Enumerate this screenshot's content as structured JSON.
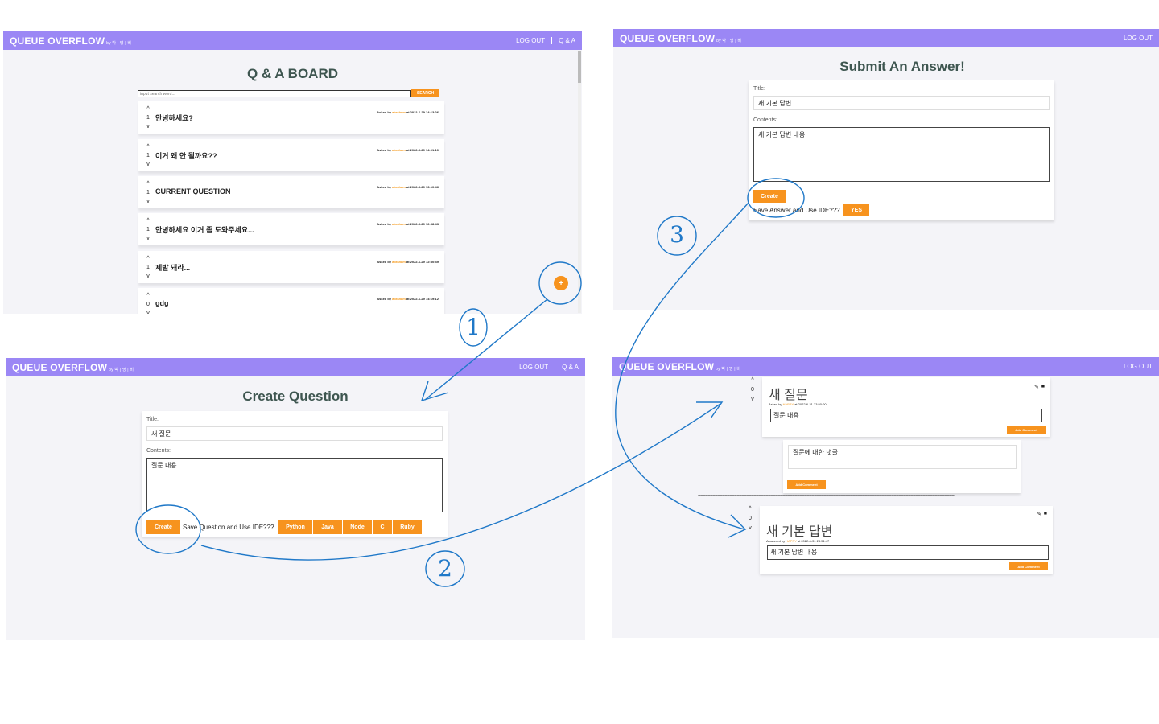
{
  "brand": {
    "name": "QUEUE OVERFLOW",
    "by": "by 박 | 명 | 비"
  },
  "nav": {
    "logout": "LOG OUT",
    "qa": "Q & A"
  },
  "board": {
    "title": "Q & A BOARD",
    "search_placeholder": "input search word...",
    "search_button": "SEARCH",
    "questions": [
      {
        "votes": "1",
        "title": "안녕하세요?",
        "asked_by": "Asked by",
        "user": "abraham",
        "at": "at 2022-6-29 14:13:26"
      },
      {
        "votes": "1",
        "title": "이거 왜 안 될까요??",
        "asked_by": "Asked by",
        "user": "abraham",
        "at": "at 2022-6-29 14:01:10"
      },
      {
        "votes": "1",
        "title": "CURRENT QUESTION",
        "asked_by": "Asked by",
        "user": "abraham",
        "at": "at 2022-6-29 13:10:46"
      },
      {
        "votes": "1",
        "title": "안녕하세요 이거 좀 도와주세요...",
        "asked_by": "Asked by",
        "user": "abraham",
        "at": "at 2022-6-29 12:58:43"
      },
      {
        "votes": "1",
        "title": "제발 돼라...",
        "asked_by": "Asked by",
        "user": "abraham",
        "at": "at 2022-6-29 12:30:49"
      },
      {
        "votes": "0",
        "title": "gdg",
        "asked_by": "Asked by",
        "user": "abraham",
        "at": "at 2022-6-29 14:19:12"
      }
    ],
    "add_button": "+"
  },
  "answer": {
    "title": "Submit An Answer!",
    "title_label": "Title:",
    "title_value": "새 기본 답변",
    "contents_label": "Contents:",
    "contents_value": "새 기본 답변 내용",
    "create": "Create",
    "save_text": "Save Answer and Use IDE???",
    "yes": "YES"
  },
  "create": {
    "title": "Create Question",
    "title_label": "Title:",
    "title_value": "새 질문",
    "contents_label": "Contents:",
    "contents_value": "질문 내용",
    "create": "Create",
    "save_text": "Save Question and Use IDE???",
    "langs": [
      "Python",
      "Java",
      "Node",
      "C",
      "Ruby"
    ]
  },
  "detail": {
    "question_votes": "0",
    "question_title": "새 질문",
    "question_asked_by": "Asked by",
    "question_user": "HAPPY",
    "question_at": "at 2022-6-31 23:50:00",
    "question_body": "질문 내용",
    "add_comment": "Add Comment",
    "comment_text": "질문에 대한 댓글",
    "divider": "==========================================================================================================",
    "answer_votes": "0",
    "answer_title": "새 기본 답변",
    "answer_by": "Answered by",
    "answer_user": "HAPPY",
    "answer_at": "at 2022-6-31 23:51:47",
    "answer_body": "새 기본 답변 내용"
  },
  "steps": [
    "1",
    "2",
    "3"
  ],
  "colors": {
    "nav": "#9b87f5",
    "accent": "#f7931e",
    "annotation": "#1f78c8",
    "title": "#3e5650"
  }
}
